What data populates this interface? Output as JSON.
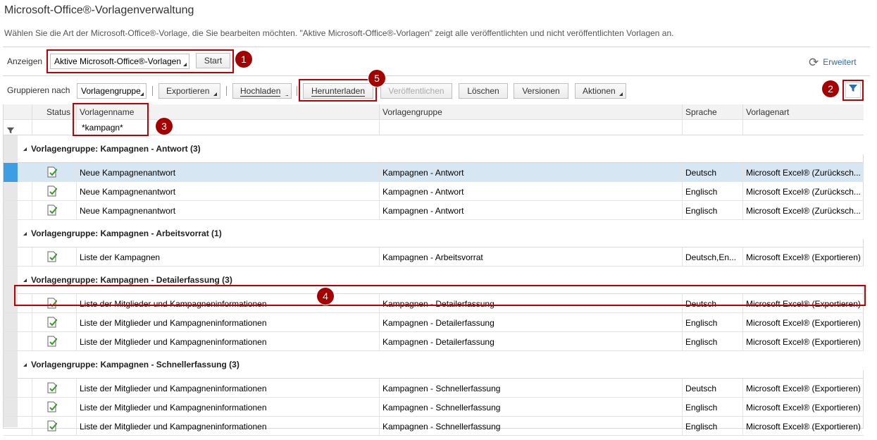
{
  "page": {
    "title": "Microsoft-Office®-Vorlagenverwaltung",
    "description": "Wählen Sie die Art der Microsoft-Office®-Vorlage, die Sie bearbeiten möchten. \"Aktive Microsoft-Office®-Vorlagen\" zeigt alle veröffentlichten und nicht veröffentlichten Vorlagen an."
  },
  "toolbar1": {
    "show_label": "Anzeigen",
    "show_value": "Aktive Microsoft-Office®-Vorlagen",
    "start_label": "Start",
    "advanced_label": "Erweitert"
  },
  "toolbar2": {
    "group_label": "Gruppieren nach",
    "group_value": "Vorlagengruppe",
    "export_label": "Exportieren",
    "upload_label": "Hochladen",
    "download_label": "Herunterladen",
    "publish_label": "Veröffentlichen",
    "delete_label": "Löschen",
    "versions_label": "Versionen",
    "actions_label": "Aktionen"
  },
  "badges": [
    "1",
    "2",
    "3",
    "4",
    "5"
  ],
  "table": {
    "columns": [
      "Status",
      "Vorlagenname",
      "Vorlagengruppe",
      "Sprache",
      "Vorlagenart"
    ],
    "filter_name": "*kampagn*",
    "groups": [
      {
        "label": "Vorlagengruppe: Kampagnen - Antwort (3)",
        "rows": [
          {
            "name": "Neue Kampagnenantwort",
            "group": "Kampagnen - Antwort",
            "lang": "Deutsch",
            "type": "Microsoft Excel® (Zurücksch..."
          },
          {
            "name": "Neue Kampagnenantwort",
            "group": "Kampagnen - Antwort",
            "lang": "Englisch",
            "type": "Microsoft Excel® (Zurücksch..."
          },
          {
            "name": "Neue Kampagnenantwort",
            "group": "Kampagnen - Antwort",
            "lang": "Englisch",
            "type": "Microsoft Excel® (Zurücksch..."
          }
        ]
      },
      {
        "label": "Vorlagengruppe: Kampagnen - Arbeitsvorrat (1)",
        "rows": [
          {
            "name": "Liste der Kampagnen",
            "group": "Kampagnen - Arbeitsvorrat",
            "lang": "Deutsch,En...",
            "type": "Microsoft Excel® (Exportieren)"
          }
        ]
      },
      {
        "label": "Vorlagengruppe: Kampagnen - Detailerfassung (3)",
        "rows": [
          {
            "name": "Liste der Mitglieder und Kampagneninformationen",
            "group": "Kampagnen - Detailerfassung",
            "lang": "Deutsch",
            "type": "Microsoft Excel® (Exportieren)"
          },
          {
            "name": "Liste der Mitglieder und Kampagneninformationen",
            "group": "Kampagnen - Detailerfassung",
            "lang": "Englisch",
            "type": "Microsoft Excel® (Exportieren)"
          },
          {
            "name": "Liste der Mitglieder und Kampagneninformationen",
            "group": "Kampagnen - Detailerfassung",
            "lang": "Englisch",
            "type": "Microsoft Excel® (Exportieren)"
          }
        ]
      },
      {
        "label": "Vorlagengruppe: Kampagnen - Schnellerfassung (3)",
        "rows": [
          {
            "name": "Liste der Mitglieder und Kampagneninformationen",
            "group": "Kampagnen - Schnellerfassung",
            "lang": "Deutsch",
            "type": "Microsoft Excel® (Exportieren)"
          },
          {
            "name": "Liste der Mitglieder und Kampagneninformationen",
            "group": "Kampagnen - Schnellerfassung",
            "lang": "Englisch",
            "type": "Microsoft Excel® (Exportieren)"
          },
          {
            "name": "Liste der Mitglieder und Kampagneninformationen",
            "group": "Kampagnen - Schnellerfassung",
            "lang": "Englisch",
            "type": "Microsoft Excel® (Exportieren)"
          }
        ]
      }
    ]
  },
  "colors": {
    "highlight": "#c00000",
    "badge": "#a50000",
    "selected_row": "#d6e6f2",
    "link": "#2a6db5"
  }
}
